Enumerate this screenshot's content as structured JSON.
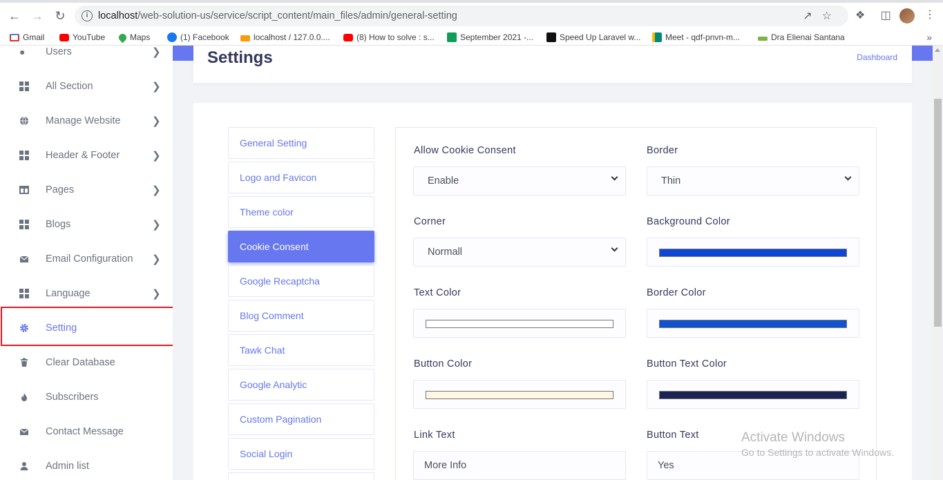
{
  "browser": {
    "url_host": "localhost",
    "url_path": "/web-solution-us/service/script_content/main_files/admin/general-setting",
    "bookmarks": [
      {
        "label": "Gmail",
        "color": "#d93025"
      },
      {
        "label": "YouTube",
        "color": "#ff0000"
      },
      {
        "label": "Maps",
        "color": "#34a853"
      },
      {
        "label": "(1) Facebook",
        "color": "#1877f2"
      },
      {
        "label": "localhost / 127.0.0....",
        "color": "#f89c0e"
      },
      {
        "label": "(8) How to solve : s...",
        "color": "#ff0000"
      },
      {
        "label": "September 2021 -...",
        "color": "#0f9d58"
      },
      {
        "label": "Speed Up Laravel w...",
        "color": "#111111"
      },
      {
        "label": "Meet - qdf-pnvn-m...",
        "color": "#00897b"
      },
      {
        "label": "Dra Elienai Santana",
        "color": "#7cb342"
      }
    ]
  },
  "sidebar": {
    "items": [
      {
        "label": "Users",
        "icon": "users-icon",
        "chevron": true
      },
      {
        "label": "All Section",
        "icon": "grid-icon",
        "chevron": true
      },
      {
        "label": "Manage Website",
        "icon": "globe-icon",
        "chevron": true
      },
      {
        "label": "Header & Footer",
        "icon": "grid-icon",
        "chevron": true
      },
      {
        "label": "Pages",
        "icon": "columns-icon",
        "chevron": true
      },
      {
        "label": "Blogs",
        "icon": "grid-icon",
        "chevron": true
      },
      {
        "label": "Email Configuration",
        "icon": "envelope-icon",
        "chevron": true
      },
      {
        "label": "Language",
        "icon": "grid-icon",
        "chevron": true
      },
      {
        "label": "Setting",
        "icon": "gear-icon",
        "chevron": false
      },
      {
        "label": "Clear Database",
        "icon": "trash-icon",
        "chevron": false
      },
      {
        "label": "Subscribers",
        "icon": "fire-icon",
        "chevron": false
      },
      {
        "label": "Contact Message",
        "icon": "envelope-icon",
        "chevron": false
      },
      {
        "label": "Admin list",
        "icon": "user-icon",
        "chevron": false
      }
    ]
  },
  "header": {
    "title": "Settings",
    "breadcrumb": "Dashboard"
  },
  "tabs": [
    "General Setting",
    "Logo and Favicon",
    "Theme color",
    "Cookie Consent",
    "Google Recaptcha",
    "Blog Comment",
    "Tawk Chat",
    "Google Analytic",
    "Custom Pagination",
    "Social Login"
  ],
  "active_tab": "Cookie Consent",
  "form": {
    "allow_cookie_label": "Allow Cookie Consent",
    "allow_cookie_value": "Enable",
    "border_label": "Border",
    "border_value": "Thin",
    "corner_label": "Corner",
    "corner_value": "Normall",
    "bg_color_label": "Background Color",
    "bg_color": "#1046d4",
    "text_color_label": "Text Color",
    "text_color": "#ffffff",
    "border_color_label": "Border Color",
    "border_color": "#0f53d2",
    "button_color_label": "Button Color",
    "button_color": "#fff8e2",
    "button_text_color_label": "Button Text Color",
    "button_text_color": "#1a2354",
    "link_text_label": "Link Text",
    "link_text_value": "More Info",
    "button_text_label": "Button Text",
    "button_text_value": "Yes"
  },
  "watermark": {
    "line1": "Activate Windows",
    "line2": "Go to Settings to activate Windows."
  },
  "colors": {
    "accent": "#6777ef",
    "highlight": "#e3161f"
  }
}
